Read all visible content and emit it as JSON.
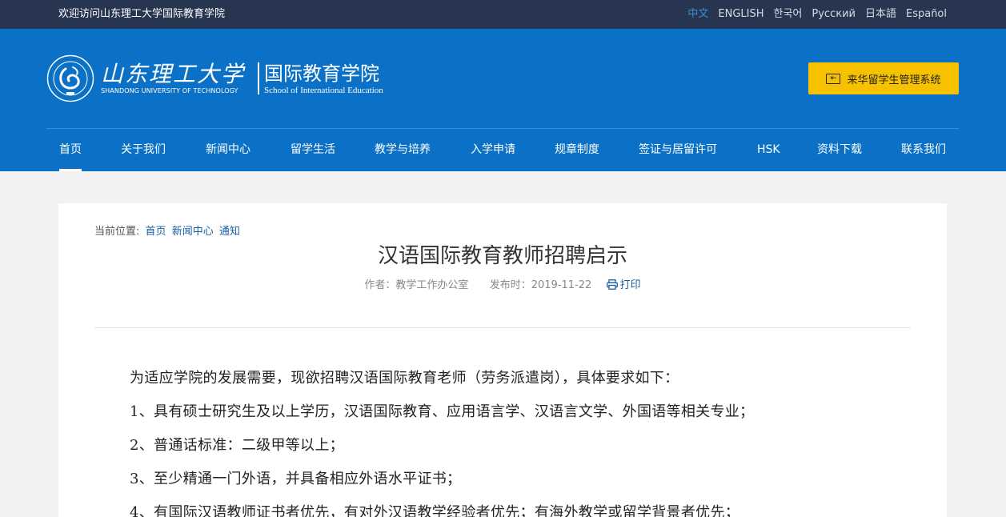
{
  "topbar": {
    "welcome": "欢迎访问山东理工大学国际教育学院",
    "languages": [
      "中文",
      "ENGLISH",
      "한국어",
      "Русский",
      "日本語",
      "Español"
    ]
  },
  "header": {
    "university_cn": "山东理工大学",
    "university_en": "SHANDONG UNIVERSITY OF TECHNOLOGY",
    "school_cn": "国际教育学院",
    "school_en": "School of International Education",
    "system_button": "来华留学生管理系统"
  },
  "nav": {
    "items": [
      "首页",
      "关于我们",
      "新闻中心",
      "留学生活",
      "教学与培养",
      "入学申请",
      "规章制度",
      "签证与居留许可",
      "HSK",
      "资料下载",
      "联系我们"
    ]
  },
  "breadcrumb": {
    "prefix": "当前位置:",
    "items": [
      "首页",
      "新闻中心",
      "通知"
    ]
  },
  "article": {
    "title": "汉语国际教育教师招聘启示",
    "author": "作者：教学工作办公室",
    "date": "发布时：2019-11-22",
    "print": "打印",
    "paragraphs": [
      "为适应学院的发展需要，现欲招聘汉语国际教育老师（劳务派遣岗），具体要求如下：",
      "1、具有硕士研究生及以上学历，汉语国际教育、应用语言学、汉语言文学、外国语等相关专业；",
      "2、普通话标准：二级甲等以上；",
      "3、至少精通一门外语，并具备相应外语水平证书；",
      "4、有国际汉语教师证书者优先，有对外汉语教学经验者优先；有海外教学或留学背景者优先；"
    ]
  },
  "colors": {
    "topbar": "#283550",
    "header": "#0b71c6",
    "button": "#f6c200",
    "link": "#1a5fa3",
    "active_lang": "#3a8fd8"
  }
}
